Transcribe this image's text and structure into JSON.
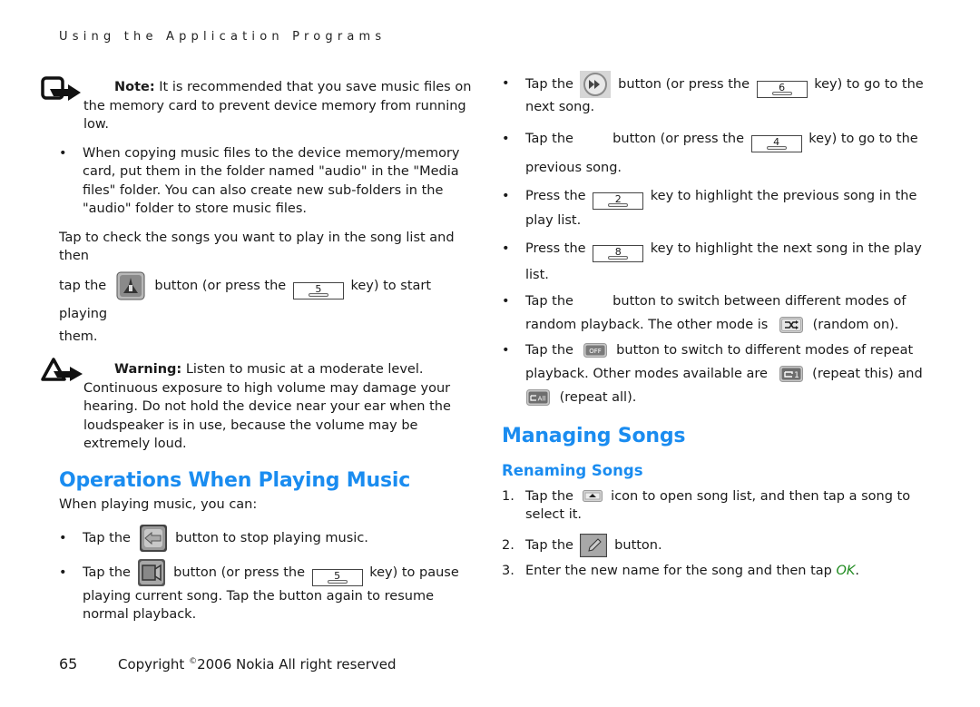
{
  "running_head": "Using the Application Programs",
  "note": {
    "label": "Note:",
    "text_first": " It is recommended that you save music files on",
    "text_rest": "the memory card to prevent device memory from running low."
  },
  "copy_bullet": "When copying music files to the device memory/memory card, put them in the folder named \"audio\" in the \"Media files\" folder. You can also create new sub-folders in the \"audio\" folder to store music files.",
  "play_instruction": {
    "line1": "Tap to check the songs you want to play in the song list and then",
    "pre": "tap the",
    "mid": "button (or press the",
    "key": "5",
    "post": "key) to start playing",
    "end": "them."
  },
  "warning": {
    "label": "Warning:",
    "text_first": " Listen to music at a moderate level.",
    "text_rest": "Continuous exposure to high volume may damage your hearing. Do not hold the device near your ear when the loudspeaker is in use, because the volume may be extremely loud."
  },
  "operations": {
    "title": "Operations When Playing Music",
    "intro": "When playing music, you can:",
    "items": [
      {
        "pre": "Tap the",
        "post": "button to stop playing music.",
        "icon": "back-arrow-icon"
      },
      {
        "pre": "Tap the",
        "mid": "button (or press the",
        "key": "5",
        "post": "key) to pause",
        "rest": "playing current song. Tap the button again to resume normal playback.",
        "icon": "pause-icon"
      }
    ]
  },
  "right_bullets": [
    {
      "pre": "Tap the",
      "mid": "button (or press the",
      "key": "6",
      "post": "key) to go to the",
      "rest": "next song.",
      "icon": "fast-forward-icon"
    },
    {
      "pre": "Tap the",
      "mid": "button (or press the",
      "key": "4",
      "post": "key) to go to the",
      "rest": "previous song.",
      "icon": "previous-icon"
    },
    {
      "pre": "Press the",
      "key": "2",
      "post": "key to highlight the previous song in the",
      "rest": "play list."
    },
    {
      "pre": "Press the",
      "key": "8",
      "post": "key to highlight the next song in the play",
      "rest": "list."
    },
    {
      "pre": "Tap the",
      "post": "button to switch between different modes of",
      "rest_pre": "random playback. The other mode is",
      "rest_post": "(random on).",
      "icon": "random-off-icon",
      "icon2": "random-on-icon"
    },
    {
      "pre": "Tap the",
      "post": "button to switch to different modes of repeat",
      "rest_pre": "playback. Other modes available are",
      "rest_post": "(repeat this) and",
      "last": "(repeat all).",
      "icon": "repeat-off-icon",
      "icon2": "repeat-one-icon",
      "icon3": "repeat-all-icon"
    }
  ],
  "managing": {
    "title": "Managing Songs",
    "subtitle": "Renaming Songs",
    "steps": [
      {
        "n": "1.",
        "pre": "Tap the",
        "post": "icon to open song list, and then tap a song to",
        "rest": "select it.",
        "icon": "song-list-icon"
      },
      {
        "n": "2.",
        "pre": "Tap the",
        "post": "button.",
        "icon": "rename-pencil-icon"
      },
      {
        "n": "3.",
        "pre": "Enter the new name for the song and then tap",
        "ok": "OK",
        "post": "."
      }
    ]
  },
  "footer": {
    "page_number": "65",
    "copyright_pre": "Copyright ",
    "copyright_symbol": "©",
    "copyright_post": "2006 Nokia All right reserved"
  }
}
